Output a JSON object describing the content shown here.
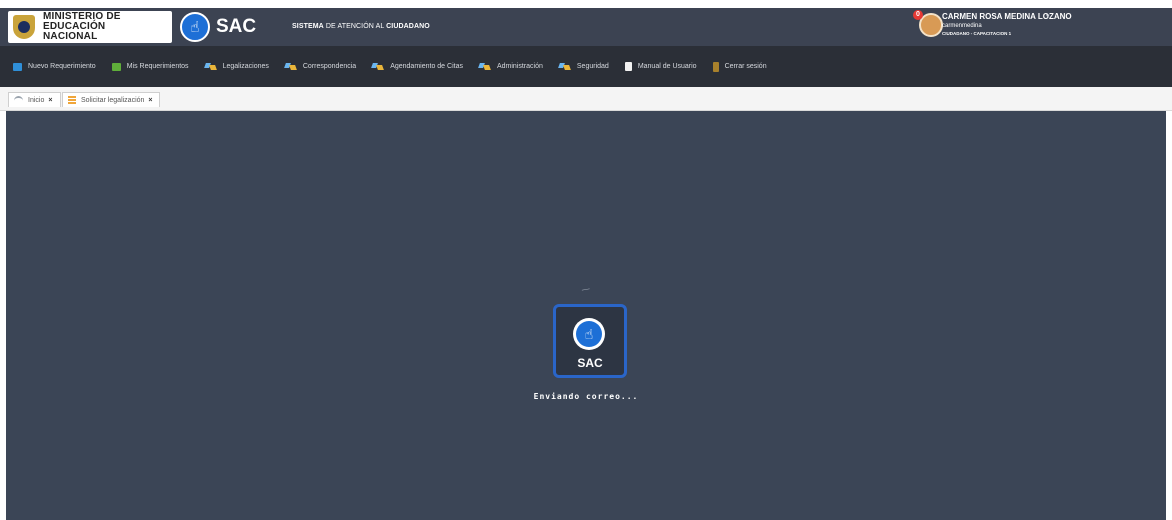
{
  "header": {
    "ministry_line1": "MINISTERIO DE EDUCACIÓN",
    "ministry_line2": "NACIONAL",
    "logo_word": "SAC",
    "logo_symbol": "☝",
    "system_title_prefix": "SISTEMA",
    "system_title_middle": " DE ATENCIÓN AL ",
    "system_title_suffix": "CIUDADANO",
    "user": {
      "notification_count": "0",
      "name": "CARMEN ROSA MEDINA LOZANO",
      "caret": "▾",
      "login": "carmenmedina",
      "role": "CIUDADANO - CAPACITACION 1"
    }
  },
  "menu": {
    "items": [
      {
        "label": "Nuevo Requerimiento",
        "icon": "book-icon"
      },
      {
        "label": "Mis Requerimientos",
        "icon": "list-icon"
      },
      {
        "label": "Legalizaciones",
        "icon": "arrow-icon"
      },
      {
        "label": "Correspondencia",
        "icon": "arrow-icon"
      },
      {
        "label": "Agendamiento de Citas",
        "icon": "arrow-icon"
      },
      {
        "label": "Administración",
        "icon": "arrow-icon"
      },
      {
        "label": "Seguridad",
        "icon": "arrow-icon"
      },
      {
        "label": "Manual de Usuario",
        "icon": "document-icon"
      },
      {
        "label": "Cerrar sesión",
        "icon": "door-icon"
      }
    ]
  },
  "tabs": [
    {
      "label": "Inicio",
      "close": "×"
    },
    {
      "label": "Solicitar legalización",
      "close": "×"
    }
  ],
  "loader": {
    "logo_word": "SAC",
    "logo_symbol": "☝",
    "message": "Enviando correo..."
  },
  "colors": {
    "topbar": "#3c4352",
    "menubar": "#2b2f37",
    "overlay": "#3b4556",
    "accent": "#1d6fd6",
    "notification": "#e53935"
  }
}
